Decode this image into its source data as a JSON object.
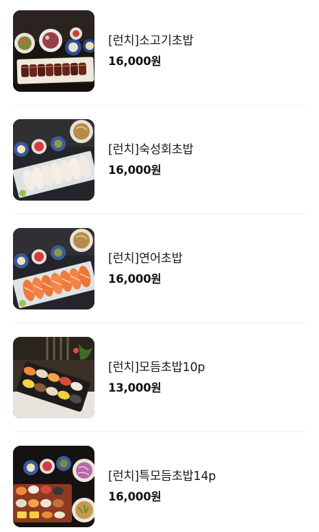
{
  "menu": {
    "items": [
      {
        "name": "[런치]소고기초밥",
        "price": "16,000원",
        "image": "beef-sushi-photo"
      },
      {
        "name": "[런치]숙성회초밥",
        "price": "16,000원",
        "image": "aged-fish-sushi-photo"
      },
      {
        "name": "[런치]연어초밥",
        "price": "16,000원",
        "image": "salmon-sushi-photo"
      },
      {
        "name": "[런치]모듬초밥10p",
        "price": "13,000원",
        "image": "assorted-sushi-10p-photo"
      },
      {
        "name": "[런치]특모듬초밥14p",
        "price": "16,000원",
        "image": "special-assorted-sushi-14p-photo"
      }
    ]
  }
}
